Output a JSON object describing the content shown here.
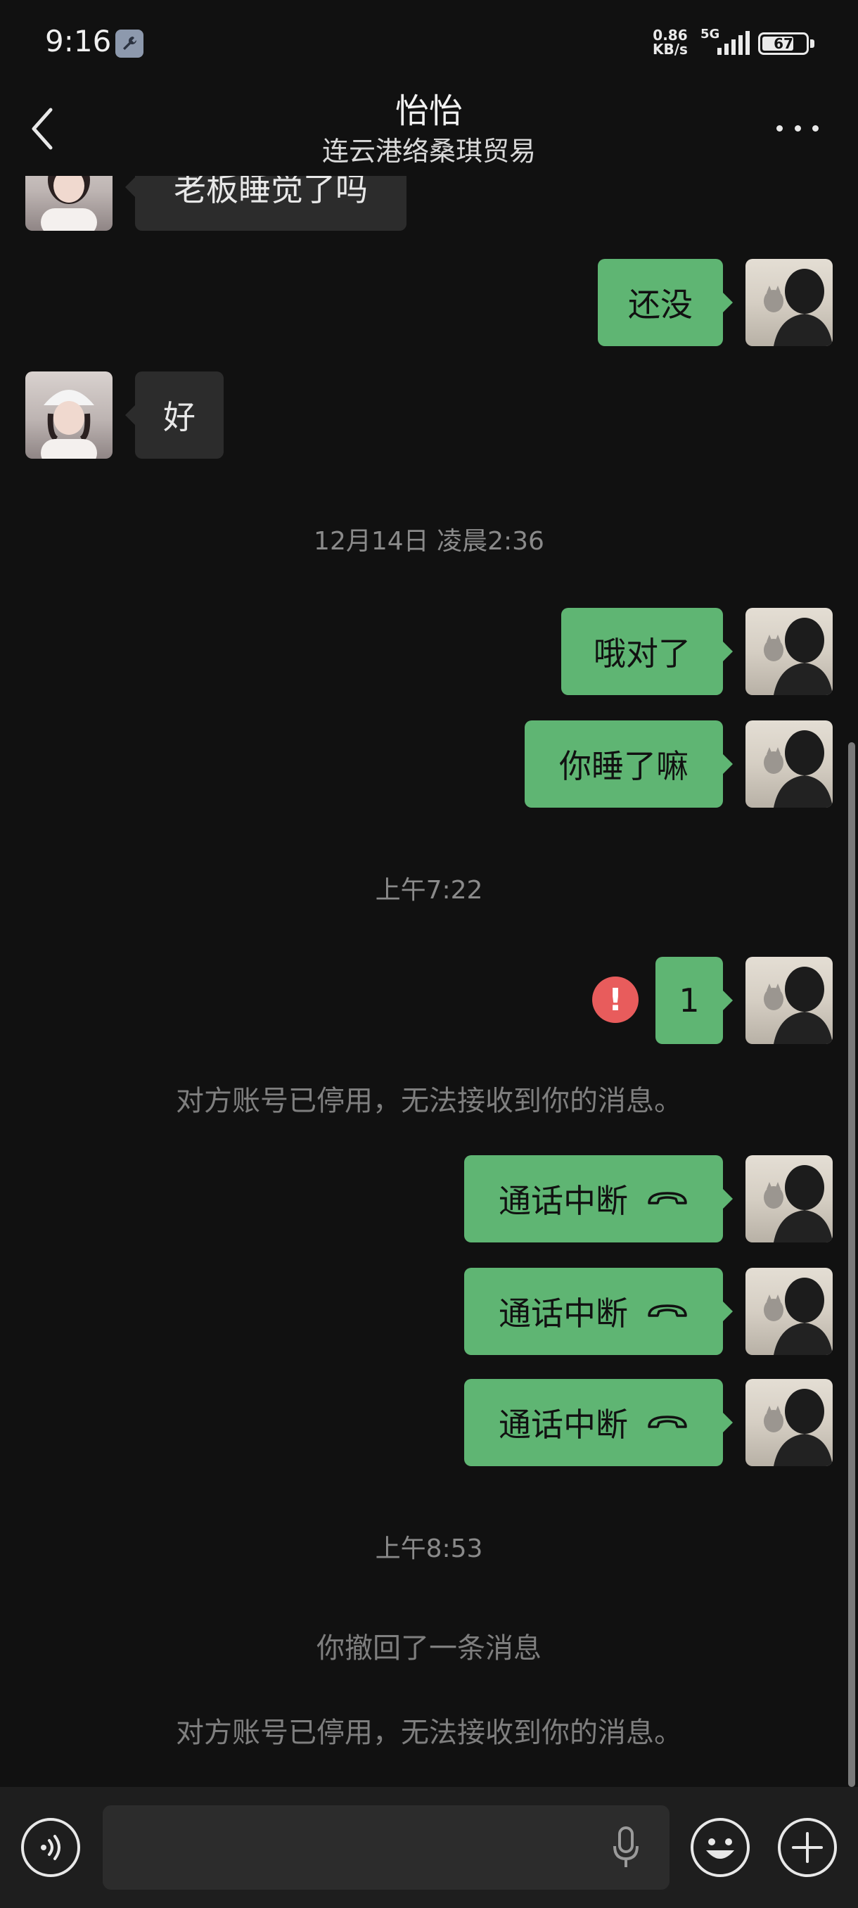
{
  "status_bar": {
    "time": "9:16",
    "net_speed_value": "0.86",
    "net_speed_unit": "KB/s",
    "network": "5G",
    "battery": "67",
    "battery_level": 0.67
  },
  "header": {
    "title": "怡怡",
    "subtitle": "连云港络桑琪贸易"
  },
  "messages": [
    {
      "sender": "contact",
      "text": "老板睡觉了吗"
    },
    {
      "sender": "me",
      "text": "还没"
    },
    {
      "sender": "contact",
      "text": "好"
    },
    {
      "type": "time",
      "text": "12月14日 凌晨2:36"
    },
    {
      "sender": "me",
      "text": "哦对了"
    },
    {
      "sender": "me",
      "text": "你睡了嘛"
    },
    {
      "type": "time",
      "text": "上午7:22"
    },
    {
      "sender": "me",
      "text": "1",
      "failed": true,
      "error_mark": "!"
    },
    {
      "type": "system",
      "text": "对方账号已停用，无法接收到你的消息。"
    },
    {
      "sender": "me",
      "text": "通话中断",
      "icon": "call-ended-icon"
    },
    {
      "sender": "me",
      "text": "通话中断",
      "icon": "call-ended-icon"
    },
    {
      "sender": "me",
      "text": "通话中断",
      "icon": "call-ended-icon"
    },
    {
      "type": "time",
      "text": "上午8:53"
    },
    {
      "type": "system",
      "text": "你撤回了一条消息"
    },
    {
      "type": "system",
      "text": "对方账号已停用，无法接收到你的消息。"
    }
  ],
  "input_bar": {
    "placeholder": "",
    "icons": [
      "voice-icon",
      "mic-icon",
      "emoji-icon",
      "plus-icon"
    ]
  },
  "colors": {
    "background": "#111111",
    "outgoing_bubble": "#5fb573",
    "incoming_bubble": "#2c2c2c",
    "error": "#e85c5c"
  }
}
